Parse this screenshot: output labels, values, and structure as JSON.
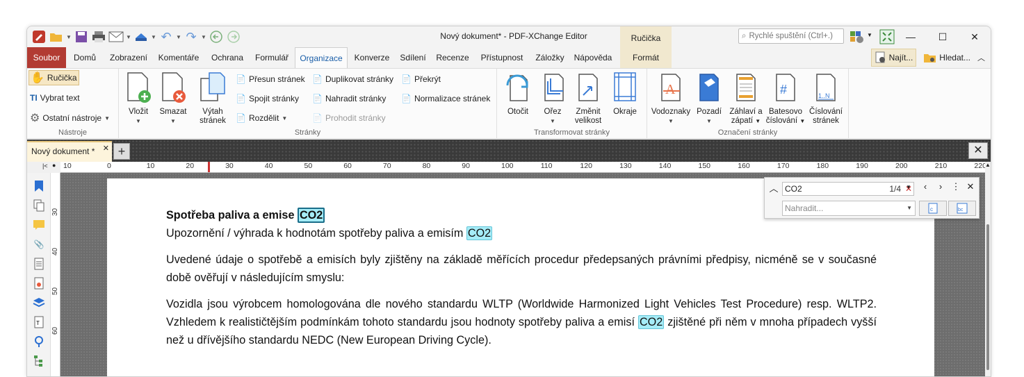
{
  "window": {
    "title": "Nový dokument* - PDF-XChange Editor",
    "context_tab_group": "Ručička"
  },
  "quick_launch": {
    "placeholder": "Rychlé spuštění (Ctrl+.)"
  },
  "menu": {
    "tabs": [
      "Soubor",
      "Domů",
      "Zobrazení",
      "Komentáře",
      "Ochrana",
      "Formulář",
      "Organizace",
      "Konverze",
      "Sdílení",
      "Recenze",
      "Přístupnost",
      "Záložky",
      "Nápověda",
      "Formát"
    ],
    "active": "Organizace",
    "find_label": "Najít...",
    "search_label": "Hledat..."
  },
  "ribbon": {
    "tools": {
      "name": "Nástroje",
      "hand": "Ručička",
      "select_text": "Vybrat text",
      "other_tools": "Ostatní nástroje"
    },
    "pages": {
      "name": "Stránky",
      "insert": "Vložit",
      "delete": "Smazat",
      "extract_1": "Výtah",
      "extract_2": "stránek",
      "move": "Přesun stránek",
      "merge": "Spojit stránky",
      "split": "Rozdělit",
      "duplicate": "Duplikovat stránky",
      "replace": "Nahradit stránky",
      "swap": "Prohodit stránky",
      "overlay": "Překrýt",
      "normalize": "Normalizace stránek"
    },
    "transform": {
      "name": "Transformovat stránky",
      "rotate": "Otočit",
      "crop": "Ořez",
      "resize_1": "Změnit",
      "resize_2": "velikost",
      "margins": "Okraje"
    },
    "marking": {
      "name": "Označení stránky",
      "watermarks": "Vodoznaky",
      "backgrounds": "Pozadí",
      "header_1": "Záhlaví a",
      "header_2": "zápatí",
      "bates_1": "Batesovo",
      "bates_2": "číslování",
      "numbering_1": "Číslování",
      "numbering_2": "stránek"
    }
  },
  "document_tab": {
    "label": "Nový dokument *"
  },
  "ruler": {
    "h_ticks": [
      "10",
      "0",
      "10",
      "20",
      "30",
      "40",
      "50",
      "60",
      "70",
      "80",
      "90",
      "100",
      "110",
      "120",
      "130",
      "140",
      "150",
      "160",
      "170",
      "180",
      "190",
      "200",
      "210",
      "220"
    ],
    "v_ticks": [
      "30",
      "40",
      "50",
      "60"
    ]
  },
  "find_panel": {
    "query": "CO2",
    "count": "1/4",
    "replace_placeholder": "Nahradit..."
  },
  "doc": {
    "heading_text": "Spotřeba paliva a emise ",
    "heading_hit": "CO2",
    "subheading_text": "Upozornění / výhrada k hodnotám spotřeby paliva a emisím ",
    "subheading_hit": "CO2",
    "para1": "Uvedené údaje o spotřebě a emisích byly zjištěny na základě měřících procedur předepsaných právními předpisy, nicméně se v současné době ověřují v následujícím smyslu:",
    "para2_a": "Vozidla jsou výrobcem homologována dle nového standardu WLTP (Worldwide Harmonized Light Vehicles Test Procedure) resp. WLTP2. Vzhledem k realističtějším podmínkám tohoto standardu jsou hodnoty spotřeby paliva a emisí ",
    "para2_hit": "CO2",
    "para2_b": " zjištěné při něm v mnoha případech vyšší než u dřívějšího standardu NEDC (New European Driving Cycle)."
  },
  "colors": {
    "file_tab": "#b23b33",
    "active_tab_text": "#1a5ea8",
    "highlight": "#a5ecf7",
    "context_tab": "#f1e8cf"
  }
}
